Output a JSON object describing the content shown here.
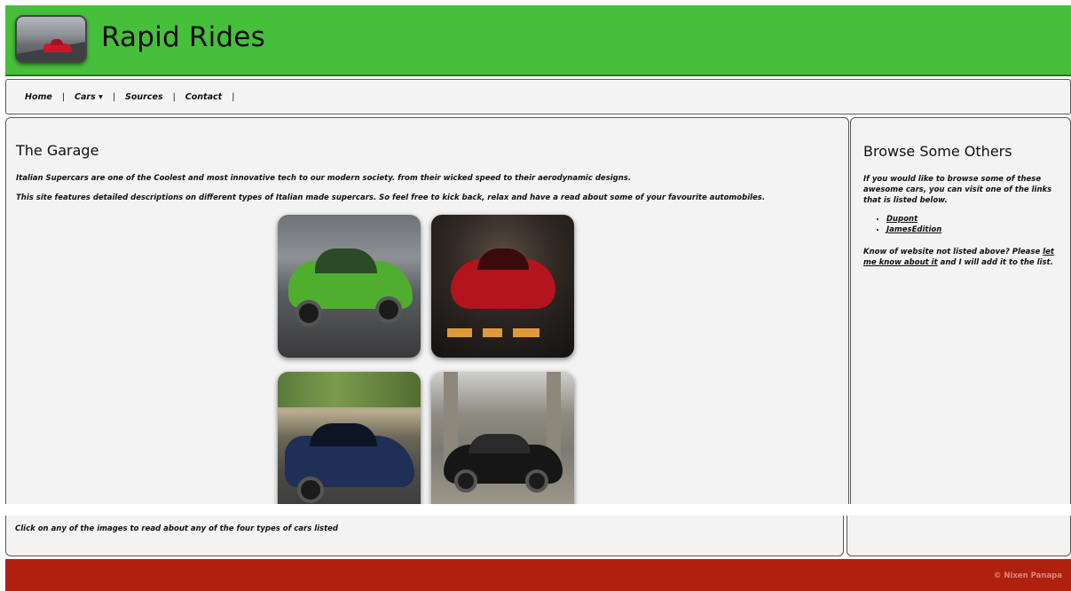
{
  "header": {
    "site_title": "Rapid Rides",
    "brand_color": "#46c03a"
  },
  "nav": {
    "items": [
      "Home",
      "Cars ▾",
      "Sources",
      "Contact"
    ],
    "separator": "|"
  },
  "main": {
    "heading": "The Garage",
    "paragraph_1": "Italian Supercars are one of the Coolest and most innovative tech to our modern society. from their wicked speed to their aerodynamic designs.",
    "paragraph_2": "This site features detailed descriptions on different types of Italian made supercars. So feel free to kick back, relax and have a read about some of your favourite automobiles."
  },
  "aside": {
    "heading": "Browse Some Others",
    "intro": "If you would like to browse some of these awesome cars, you can visit one of the links that is listed below.",
    "links": [
      "Dupont",
      "JamesEdition"
    ],
    "note_prefix": "Know of website not listed above? Please ",
    "note_link": "let me know about it",
    "note_suffix": " and I will add it to the list."
  },
  "bottom": {
    "caption": "Click on any of the images to read about any of the four types of cars listed"
  },
  "footer": {
    "copyright": "© Nixen Panapa",
    "color": "#b0200f"
  }
}
